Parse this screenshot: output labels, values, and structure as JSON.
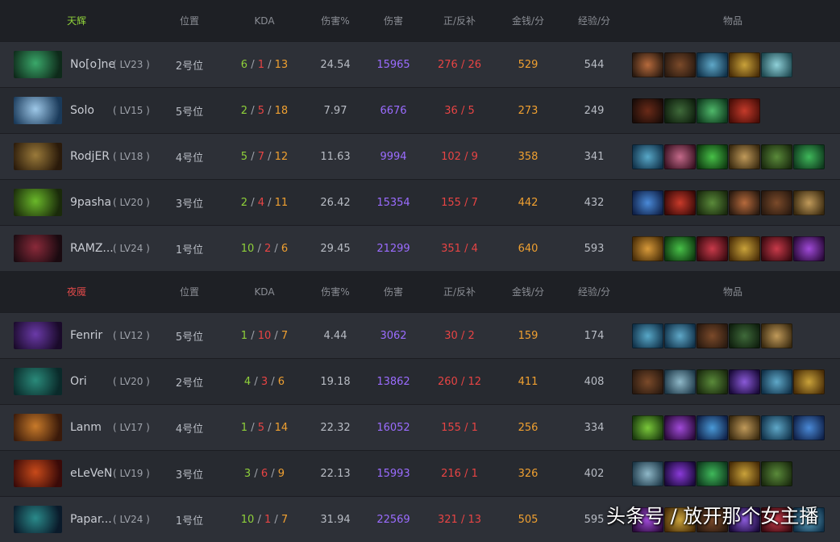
{
  "columns": {
    "position": "位置",
    "kda": "KDA",
    "damage_pct": "伤害%",
    "damage": "伤害",
    "lh_dn": "正/反补",
    "gpm": "金钱/分",
    "xpm": "经验/分",
    "items": "物品"
  },
  "teams": [
    {
      "name": "天辉",
      "color": "#8fd13a",
      "players": [
        {
          "name": "No[o]ne",
          "level": "LV23",
          "position": "2号位",
          "kills": "6",
          "deaths": "1",
          "assists": "13",
          "damage_pct": "24.54",
          "damage": "15965",
          "lh_dn": "276 / 26",
          "gpm": "529",
          "xpm": "544",
          "items": [
            "#b66a3c,#2a1a10",
            "#7b4a2a,#2a1a10",
            "#5fa8c8,#11324a",
            "#c9a23a,#4a2e08",
            "#8fd0d8,#1f4a52"
          ]
        },
        {
          "name": "Solo",
          "level": "LV15",
          "position": "5号位",
          "kills": "2",
          "deaths": "5",
          "assists": "18",
          "damage_pct": "7.97",
          "damage": "6676",
          "lh_dn": "36 / 5",
          "gpm": "273",
          "xpm": "249",
          "items": [
            "#6a2a18,#1a0c08",
            "#3f6a3a,#0f1f0e",
            "#4fb86a,#0f3a1e",
            "#c43a2a,#4a0e08"
          ]
        },
        {
          "name": "RodjER",
          "level": "LV18",
          "position": "4号位",
          "kills": "5",
          "deaths": "7",
          "assists": "12",
          "damage_pct": "11.63",
          "damage": "9994",
          "lh_dn": "102 / 9",
          "gpm": "358",
          "xpm": "341",
          "items": [
            "#58a8c8,#11324a",
            "#c46a8a,#3a1222",
            "#48c048,#0e3a10",
            "#c09a5a,#3a2a10",
            "#5a8a3a,#1a2a0e",
            "#3fb85a,#0f3a1e"
          ]
        },
        {
          "name": "9pasha",
          "level": "LV20",
          "position": "3号位",
          "kills": "2",
          "deaths": "4",
          "assists": "11",
          "damage_pct": "26.42",
          "damage": "15354",
          "lh_dn": "155 / 7",
          "gpm": "442",
          "xpm": "432",
          "items": [
            "#4a8ad8,#10224a",
            "#c83a2a,#3a0a08",
            "#5a8a3a,#1a2a0e",
            "#b66a3c,#2a1a10",
            "#7b4a2a,#2a1a10",
            "#c09a5a,#3a2a10"
          ]
        },
        {
          "name": "RAMZ...",
          "level": "LV24",
          "position": "1号位",
          "kills": "10",
          "deaths": "2",
          "assists": "6",
          "damage_pct": "29.45",
          "damage": "21299",
          "lh_dn": "351 / 4",
          "gpm": "640",
          "xpm": "593",
          "items": [
            "#d89a3a,#4a2e08",
            "#48c048,#0e3a10",
            "#c83a4a,#3a0a10",
            "#c9a23a,#4a2e08",
            "#c83a4a,#3a0a10",
            "#a04ad8,#2a0a3a"
          ]
        }
      ]
    },
    {
      "name": "夜魇",
      "color": "#e24a4a",
      "players": [
        {
          "name": "Fenrir",
          "level": "LV12",
          "position": "5号位",
          "kills": "1",
          "deaths": "10",
          "assists": "7",
          "damage_pct": "4.44",
          "damage": "3062",
          "lh_dn": "30 / 2",
          "gpm": "159",
          "xpm": "174",
          "items": [
            "#58a8c8,#11324a",
            "#5fa8c8,#11324a",
            "#7b4a2a,#2a1a10",
            "#3f6a3a,#0f1f0e",
            "#c09a5a,#3a2a10"
          ]
        },
        {
          "name": "Ori",
          "level": "LV20",
          "position": "2号位",
          "kills": "4",
          "deaths": "3",
          "assists": "6",
          "damage_pct": "19.18",
          "damage": "13862",
          "lh_dn": "260 / 12",
          "gpm": "411",
          "xpm": "408",
          "items": [
            "#7b4a2a,#2a1a10",
            "#8fb8c8,#1f3a4a",
            "#5a8a3a,#1a2a0e",
            "#8a5ad8,#1a0a3a",
            "#5fa8c8,#11324a",
            "#c9a23a,#4a2e08"
          ]
        },
        {
          "name": "Lanm",
          "level": "LV17",
          "position": "4号位",
          "kills": "1",
          "deaths": "5",
          "assists": "14",
          "damage_pct": "22.32",
          "damage": "16052",
          "lh_dn": "155 / 1",
          "gpm": "256",
          "xpm": "334",
          "items": [
            "#7ac83a,#1a3a0e",
            "#a04ad8,#2a0a3a",
            "#4a9ad8,#10224a",
            "#c09a5a,#3a2a10",
            "#5fa8c8,#11324a",
            "#4a8ad8,#10224a"
          ]
        },
        {
          "name": "eLeVeN",
          "level": "LV19",
          "position": "3号位",
          "kills": "3",
          "deaths": "6",
          "assists": "9",
          "damage_pct": "22.13",
          "damage": "15993",
          "lh_dn": "216 / 1",
          "gpm": "326",
          "xpm": "402",
          "items": [
            "#8fb8c8,#1f3a4a",
            "#8a3ad8,#1a0a3a",
            "#3fb85a,#0f3a1e",
            "#c9a23a,#4a2e08",
            "#5a8a3a,#1a2a0e"
          ]
        },
        {
          "name": "Papar...",
          "level": "LV24",
          "position": "1号位",
          "kills": "10",
          "deaths": "1",
          "assists": "7",
          "damage_pct": "31.94",
          "damage": "22569",
          "lh_dn": "321 / 13",
          "gpm": "505",
          "xpm": "595",
          "items": [
            "#a04ad8,#2a0a3a",
            "#c9a23a,#4a2e08",
            "#7b4a2a,#2a1a10",
            "#8a5ad8,#1a0a3a",
            "#c83a4a,#3a0a10",
            "#5fa8c8,#11324a"
          ]
        }
      ]
    }
  ],
  "avatar_colors": [
    [
      "#3aa86a",
      "#0e2a1a"
    ],
    [
      "#9ec8e8",
      "#1a3a5a"
    ],
    [
      "#9a7a3a",
      "#2a1a0a"
    ],
    [
      "#6ab82a",
      "#1a2a0a"
    ],
    [
      "#8a2a3a",
      "#1a0a10"
    ],
    [
      "#6a3aa8",
      "#1a0a2a"
    ],
    [
      "#2a8a7a",
      "#0a2a2a"
    ],
    [
      "#c87a2a",
      "#3a1a0a"
    ],
    [
      "#c84a1a",
      "#3a0a08"
    ],
    [
      "#2a8a8a",
      "#0a1a2a"
    ]
  ],
  "watermark": "头条号 / 放开那个女主播"
}
